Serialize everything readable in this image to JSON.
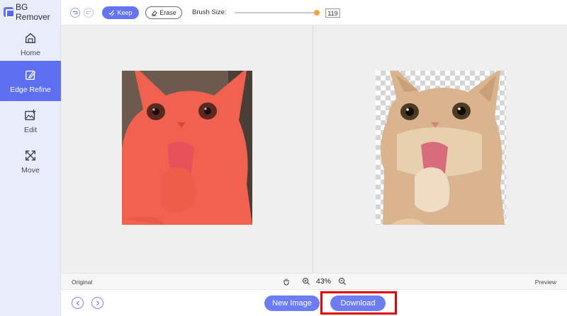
{
  "app": {
    "title": "BG Remover"
  },
  "sidebar": {
    "items": [
      {
        "label": "Home",
        "icon": "home-icon",
        "active": false
      },
      {
        "label": "Edge Refine",
        "icon": "edge-refine-icon",
        "active": true
      },
      {
        "label": "Edit",
        "icon": "edit-image-icon",
        "active": false
      },
      {
        "label": "Move",
        "icon": "move-icon",
        "active": false
      }
    ]
  },
  "toolbar": {
    "keep_label": "Keep",
    "erase_label": "Erase",
    "brush_label": "Brush Size:",
    "brush_size": "119",
    "brush_fraction": 0.98
  },
  "statusbar": {
    "original_label": "Original",
    "zoom": "43%",
    "preview_label": "Preview"
  },
  "bottom": {
    "new_image_label": "New Image",
    "download_label": "Download"
  },
  "colors": {
    "accent": "#6474f3",
    "keep_overlay": "#f0624f",
    "highlight": "#e00000"
  }
}
